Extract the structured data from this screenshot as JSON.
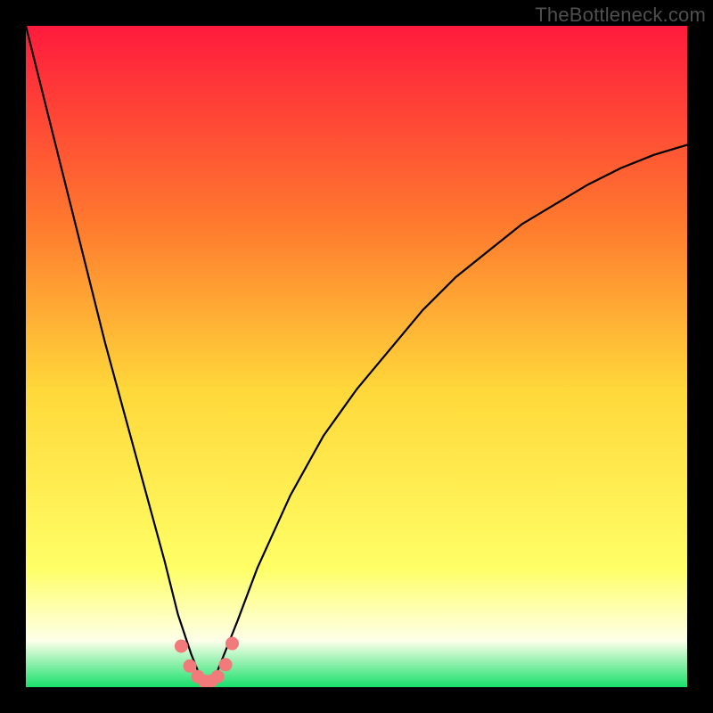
{
  "watermark": "TheBottleneck.com",
  "colors": {
    "gradient_top": "#ff1a3d",
    "gradient_mid_upper": "#ff7a2e",
    "gradient_mid": "#ffd83a",
    "gradient_mid_lower": "#ffff66",
    "gradient_pale": "#fdffe9",
    "gradient_bottom": "#18e06b",
    "frame": "#000000",
    "curve": "#000000",
    "marker_fill": "#f27a7a",
    "marker_stroke": "#f27a7a"
  },
  "chart_data": {
    "type": "line",
    "title": "",
    "xlabel": "",
    "ylabel": "",
    "xlim": [
      0,
      100
    ],
    "ylim": [
      0,
      100
    ],
    "comment": "Axes are unlabeled; values are normalized 0-100 estimates from pixel positions. Curve is a steep V dipping to ~0 near x≈27 and rising asymptotically toward ~80 on the right.",
    "series": [
      {
        "name": "curve",
        "x": [
          0,
          3,
          6,
          9,
          12,
          15,
          18,
          21,
          23,
          25,
          26,
          27,
          28,
          29,
          30,
          32,
          35,
          40,
          45,
          50,
          55,
          60,
          65,
          70,
          75,
          80,
          85,
          90,
          95,
          100
        ],
        "values": [
          100,
          88,
          76,
          64,
          52,
          41,
          30,
          19,
          11,
          5,
          2.5,
          1,
          1,
          2.5,
          5,
          10,
          18,
          29,
          38,
          45,
          51,
          57,
          62,
          66,
          70,
          73,
          76,
          78.5,
          80.5,
          82
        ]
      },
      {
        "name": "markers",
        "x": [
          23.5,
          24.8,
          26,
          27,
          28,
          29,
          30.2,
          31.2
        ],
        "values": [
          6.2,
          3.2,
          1.6,
          0.9,
          0.9,
          1.6,
          3.4,
          6.6
        ]
      }
    ]
  }
}
